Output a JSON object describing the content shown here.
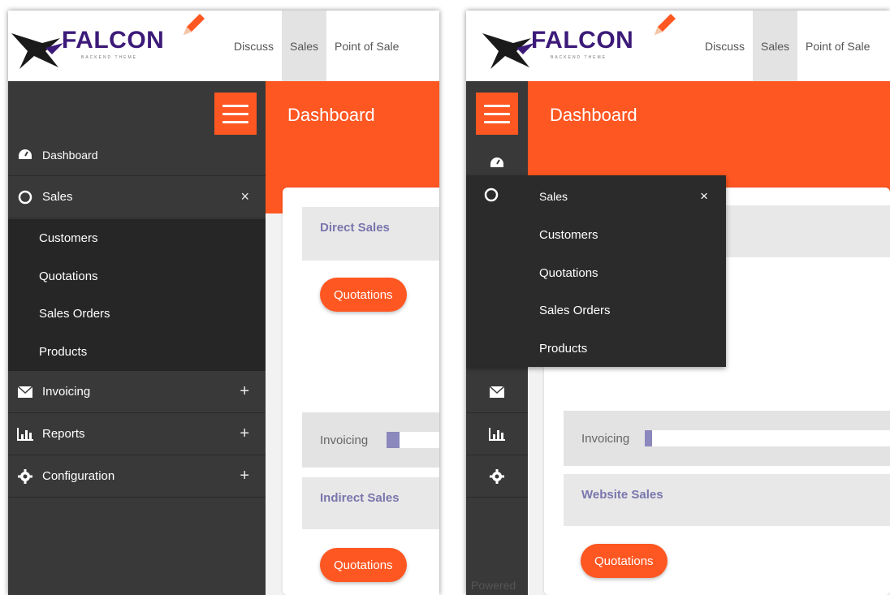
{
  "logo": {
    "name": "FALCON",
    "tagline": "BACKEND THEME"
  },
  "topnav": [
    "Discuss",
    "Sales",
    "Point of Sale"
  ],
  "active_nav": "Sales",
  "header": {
    "title": "Dashboard"
  },
  "sidebar": {
    "items": [
      {
        "label": "Dashboard",
        "icon": "dashboard-icon",
        "action": ""
      },
      {
        "label": "Sales",
        "icon": "circle-icon",
        "action": "×"
      },
      {
        "label": "Invoicing",
        "icon": "envelope-icon",
        "action": "+"
      },
      {
        "label": "Reports",
        "icon": "bar-chart-icon",
        "action": "+"
      },
      {
        "label": "Configuration",
        "icon": "gear-icon",
        "action": "+"
      }
    ],
    "sales_sub": [
      "Customers",
      "Quotations",
      "Sales Orders",
      "Products"
    ]
  },
  "sections": {
    "direct_sales": "Direct Sales",
    "indirect_sales": "Indirect Sales",
    "website_sales": "Website Sales",
    "invoicing_label": "Invoicing",
    "quotations_button": "Quotations"
  },
  "flyout": {
    "title": "Sales",
    "close": "×"
  },
  "footer": {
    "powered": "Powered"
  },
  "colors": {
    "accent": "#ff5722",
    "sidebar": "#393939",
    "section_title": "#7a76ad"
  }
}
